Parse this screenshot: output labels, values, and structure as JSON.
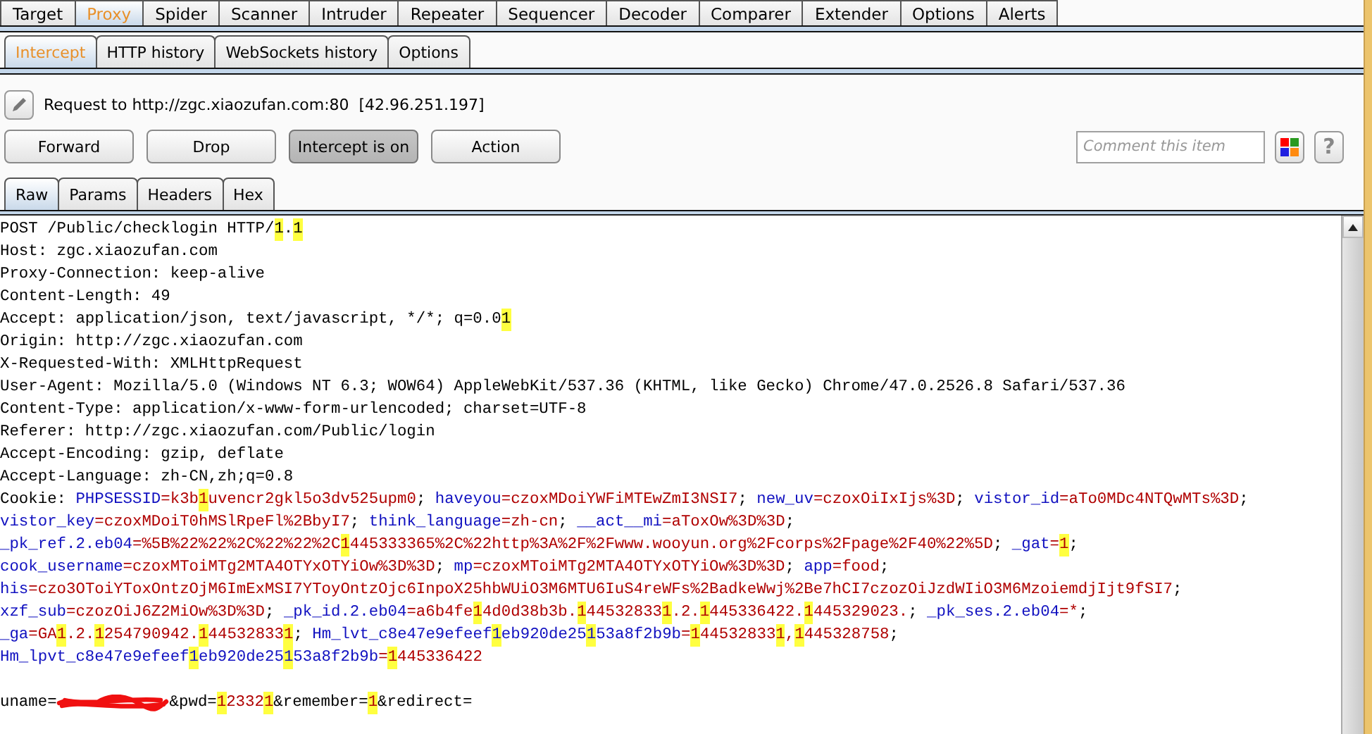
{
  "top_tabs": [
    {
      "label": "Target",
      "selected": false
    },
    {
      "label": "Proxy",
      "selected": true
    },
    {
      "label": "Spider",
      "selected": false
    },
    {
      "label": "Scanner",
      "selected": false
    },
    {
      "label": "Intruder",
      "selected": false
    },
    {
      "label": "Repeater",
      "selected": false
    },
    {
      "label": "Sequencer",
      "selected": false
    },
    {
      "label": "Decoder",
      "selected": false
    },
    {
      "label": "Comparer",
      "selected": false
    },
    {
      "label": "Extender",
      "selected": false
    },
    {
      "label": "Options",
      "selected": false
    },
    {
      "label": "Alerts",
      "selected": false
    }
  ],
  "proxy_tabs": [
    {
      "label": "Intercept",
      "selected": true
    },
    {
      "label": "HTTP history",
      "selected": false
    },
    {
      "label": "WebSockets history",
      "selected": false
    },
    {
      "label": "Options",
      "selected": false
    }
  ],
  "request_info": {
    "label": "Request to http://zgc.xiaozufan.com:80  [42.96.251.197]"
  },
  "intercept_buttons": [
    {
      "label": "Forward",
      "pressed": false
    },
    {
      "label": "Drop",
      "pressed": false
    },
    {
      "label": "Intercept is on",
      "pressed": true
    },
    {
      "label": "Action",
      "pressed": false
    }
  ],
  "comment": {
    "placeholder": "Comment this item"
  },
  "help_button": {
    "label": "?"
  },
  "message_tabs": [
    {
      "label": "Raw",
      "selected": true
    },
    {
      "label": "Params",
      "selected": false
    },
    {
      "label": "Headers",
      "selected": false
    },
    {
      "label": "Hex",
      "selected": false
    }
  ],
  "request": {
    "header_lines": [
      {
        "segments": [
          {
            "text": "POST /Public/checklogin HTTP/",
            "kind": "plain"
          },
          {
            "text": "1",
            "kind": "plain",
            "highlighted": true
          },
          {
            "text": ".",
            "kind": "plain"
          },
          {
            "text": "1",
            "kind": "plain",
            "highlighted": true
          }
        ]
      },
      {
        "segments": [
          {
            "text": "Host: zgc.xiaozufan.com",
            "kind": "plain"
          }
        ]
      },
      {
        "segments": [
          {
            "text": "Proxy-Connection: keep-alive",
            "kind": "plain"
          }
        ]
      },
      {
        "segments": [
          {
            "text": "Content-Length: 49",
            "kind": "plain"
          }
        ]
      },
      {
        "segments": [
          {
            "text": "Accept: application/json, text/javascript, */*; q=0.0",
            "kind": "plain"
          },
          {
            "text": "1",
            "kind": "plain",
            "highlighted": true
          }
        ]
      },
      {
        "segments": [
          {
            "text": "Origin: http://zgc.xiaozufan.com",
            "kind": "plain"
          }
        ]
      },
      {
        "segments": [
          {
            "text": "X-Requested-With: XMLHttpRequest",
            "kind": "plain"
          }
        ]
      },
      {
        "segments": [
          {
            "text": "User-Agent: Mozilla/5.0 (Windows NT 6.3; WOW64) AppleWebKit/537.36 (KHTML, like Gecko) Chrome/47.0.2526.8 Safari/537.36",
            "kind": "plain"
          }
        ]
      },
      {
        "segments": [
          {
            "text": "Content-Type: application/x-www-form-urlencoded; charset=UTF-8",
            "kind": "plain"
          }
        ]
      },
      {
        "segments": [
          {
            "text": "Referer: http://zgc.xiaozufan.com/Public/login",
            "kind": "plain"
          }
        ]
      },
      {
        "segments": [
          {
            "text": "Accept-Encoding: gzip, deflate",
            "kind": "plain"
          }
        ]
      },
      {
        "segments": [
          {
            "text": "Accept-Language: zh-CN,zh;q=0.8",
            "kind": "plain"
          }
        ]
      },
      {
        "segments": [
          {
            "text": "Cookie: ",
            "kind": "plain"
          },
          {
            "text": "PHPSESSID",
            "kind": "name"
          },
          {
            "text": "=k3b",
            "kind": "value"
          },
          {
            "text": "1",
            "kind": "value",
            "highlighted": true
          },
          {
            "text": "uvencr2gkl5o3dv525upm0",
            "kind": "value"
          },
          {
            "text": "; ",
            "kind": "plain"
          },
          {
            "text": "haveyou",
            "kind": "name"
          },
          {
            "text": "=czoxMDoiYWFiMTEwZmI3NSI7",
            "kind": "value"
          },
          {
            "text": "; ",
            "kind": "plain"
          },
          {
            "text": "new_uv",
            "kind": "name"
          },
          {
            "text": "=czoxOiIxIjs%3D",
            "kind": "value"
          },
          {
            "text": "; ",
            "kind": "plain"
          },
          {
            "text": "vistor_id",
            "kind": "name"
          },
          {
            "text": "=aTo0MDc4NTQwMTs%3D",
            "kind": "value"
          },
          {
            "text": ";",
            "kind": "plain"
          }
        ]
      },
      {
        "segments": [
          {
            "text": "vistor_key",
            "kind": "name"
          },
          {
            "text": "=czoxMDoiT0hMSlRpeFl%2BbyI7",
            "kind": "value"
          },
          {
            "text": "; ",
            "kind": "plain"
          },
          {
            "text": "think_language",
            "kind": "name"
          },
          {
            "text": "=zh-cn",
            "kind": "value"
          },
          {
            "text": "; ",
            "kind": "plain"
          },
          {
            "text": "__act__mi",
            "kind": "name"
          },
          {
            "text": "=aToxOw%3D%3D",
            "kind": "value"
          },
          {
            "text": ";",
            "kind": "plain"
          }
        ]
      },
      {
        "segments": [
          {
            "text": "_pk_ref.2.eb04",
            "kind": "name"
          },
          {
            "text": "=%5B%22%22%2C%22%22%2C",
            "kind": "value"
          },
          {
            "text": "1",
            "kind": "value",
            "highlighted": true
          },
          {
            "text": "445333365%2C%22http%3A%2F%2Fwww.wooyun.org%2Fcorps%2Fpage%2F40%22%5D",
            "kind": "value"
          },
          {
            "text": "; ",
            "kind": "plain"
          },
          {
            "text": "_gat",
            "kind": "name"
          },
          {
            "text": "=",
            "kind": "value"
          },
          {
            "text": "1",
            "kind": "value",
            "highlighted": true
          },
          {
            "text": ";",
            "kind": "plain"
          }
        ]
      },
      {
        "segments": [
          {
            "text": "cook_username",
            "kind": "name"
          },
          {
            "text": "=czoxMToiMTg2MTA4OTYxOTYiOw%3D%3D",
            "kind": "value"
          },
          {
            "text": "; ",
            "kind": "plain"
          },
          {
            "text": "mp",
            "kind": "name"
          },
          {
            "text": "=czoxMToiMTg2MTA4OTYxOTYiOw%3D%3D",
            "kind": "value"
          },
          {
            "text": "; ",
            "kind": "plain"
          },
          {
            "text": "app",
            "kind": "name"
          },
          {
            "text": "=food",
            "kind": "value"
          },
          {
            "text": ";",
            "kind": "plain"
          }
        ]
      },
      {
        "segments": [
          {
            "text": "his",
            "kind": "name"
          },
          {
            "text": "=czo3OToiYToxOntzOjM6ImExMSI7YToyOntzOjc6InpoX25hbWUiO3M6MTU6IuS4reWFs%2BadkeWwj%2Be7hCI7czozOiJzdWIiO3M6MzoiemdjIjt9fSI7",
            "kind": "value"
          },
          {
            "text": ";",
            "kind": "plain"
          }
        ]
      },
      {
        "segments": [
          {
            "text": "xzf_sub",
            "kind": "name"
          },
          {
            "text": "=czozOiJ6Z2MiOw%3D%3D",
            "kind": "value"
          },
          {
            "text": "; ",
            "kind": "plain"
          },
          {
            "text": "_pk_id.2.eb04",
            "kind": "name"
          },
          {
            "text": "=a6b4fe",
            "kind": "value"
          },
          {
            "text": "1",
            "kind": "value",
            "highlighted": true
          },
          {
            "text": "4d0d38b3b.",
            "kind": "value"
          },
          {
            "text": "1",
            "kind": "value",
            "highlighted": true
          },
          {
            "text": "44532833",
            "kind": "value"
          },
          {
            "text": "1",
            "kind": "value",
            "highlighted": true
          },
          {
            "text": ".2.",
            "kind": "value"
          },
          {
            "text": "1",
            "kind": "value",
            "highlighted": true
          },
          {
            "text": "445336422.",
            "kind": "value"
          },
          {
            "text": "1",
            "kind": "value",
            "highlighted": true
          },
          {
            "text": "445329023.",
            "kind": "value"
          },
          {
            "text": "; ",
            "kind": "plain"
          },
          {
            "text": "_pk_ses.2.eb04",
            "kind": "name"
          },
          {
            "text": "=*",
            "kind": "value"
          },
          {
            "text": ";",
            "kind": "plain"
          }
        ]
      },
      {
        "segments": [
          {
            "text": "_ga",
            "kind": "name"
          },
          {
            "text": "=GA",
            "kind": "value"
          },
          {
            "text": "1",
            "kind": "value",
            "highlighted": true
          },
          {
            "text": ".2.",
            "kind": "value"
          },
          {
            "text": "1",
            "kind": "value",
            "highlighted": true
          },
          {
            "text": "254790942.",
            "kind": "value"
          },
          {
            "text": "1",
            "kind": "value",
            "highlighted": true
          },
          {
            "text": "44532833",
            "kind": "value"
          },
          {
            "text": "1",
            "kind": "value",
            "highlighted": true
          },
          {
            "text": "; ",
            "kind": "plain"
          },
          {
            "text": "Hm_lvt_c8e47e9efeef",
            "kind": "name"
          },
          {
            "text": "1",
            "kind": "name",
            "highlighted": true
          },
          {
            "text": "eb920de25",
            "kind": "name"
          },
          {
            "text": "1",
            "kind": "name",
            "highlighted": true
          },
          {
            "text": "53a8f2b9b",
            "kind": "name"
          },
          {
            "text": "=",
            "kind": "value"
          },
          {
            "text": "1",
            "kind": "value",
            "highlighted": true
          },
          {
            "text": "44532833",
            "kind": "value"
          },
          {
            "text": "1",
            "kind": "value",
            "highlighted": true
          },
          {
            "text": ",",
            "kind": "value"
          },
          {
            "text": "1",
            "kind": "value",
            "highlighted": true
          },
          {
            "text": "445328758",
            "kind": "value"
          },
          {
            "text": ";",
            "kind": "plain"
          }
        ]
      },
      {
        "segments": [
          {
            "text": "Hm_lpvt_c8e47e9efeef",
            "kind": "name"
          },
          {
            "text": "1",
            "kind": "name",
            "highlighted": true
          },
          {
            "text": "eb920de25",
            "kind": "name"
          },
          {
            "text": "1",
            "kind": "name",
            "highlighted": true
          },
          {
            "text": "53a8f2b9b",
            "kind": "name"
          },
          {
            "text": "=",
            "kind": "value"
          },
          {
            "text": "1",
            "kind": "value",
            "highlighted": true
          },
          {
            "text": "445336422",
            "kind": "value"
          }
        ]
      }
    ],
    "body": {
      "segments": [
        {
          "text": "uname=",
          "kind": "plain"
        },
        {
          "kind": "redaction"
        },
        {
          "text": "&pwd=",
          "kind": "plain"
        },
        {
          "text": "1",
          "kind": "value",
          "highlighted": true
        },
        {
          "text": "2332",
          "kind": "value"
        },
        {
          "text": "1",
          "kind": "value",
          "highlighted": true
        },
        {
          "text": "&remember=",
          "kind": "plain"
        },
        {
          "text": "1",
          "kind": "value",
          "highlighted": true
        },
        {
          "text": "&redirect=",
          "kind": "plain"
        }
      ]
    }
  }
}
